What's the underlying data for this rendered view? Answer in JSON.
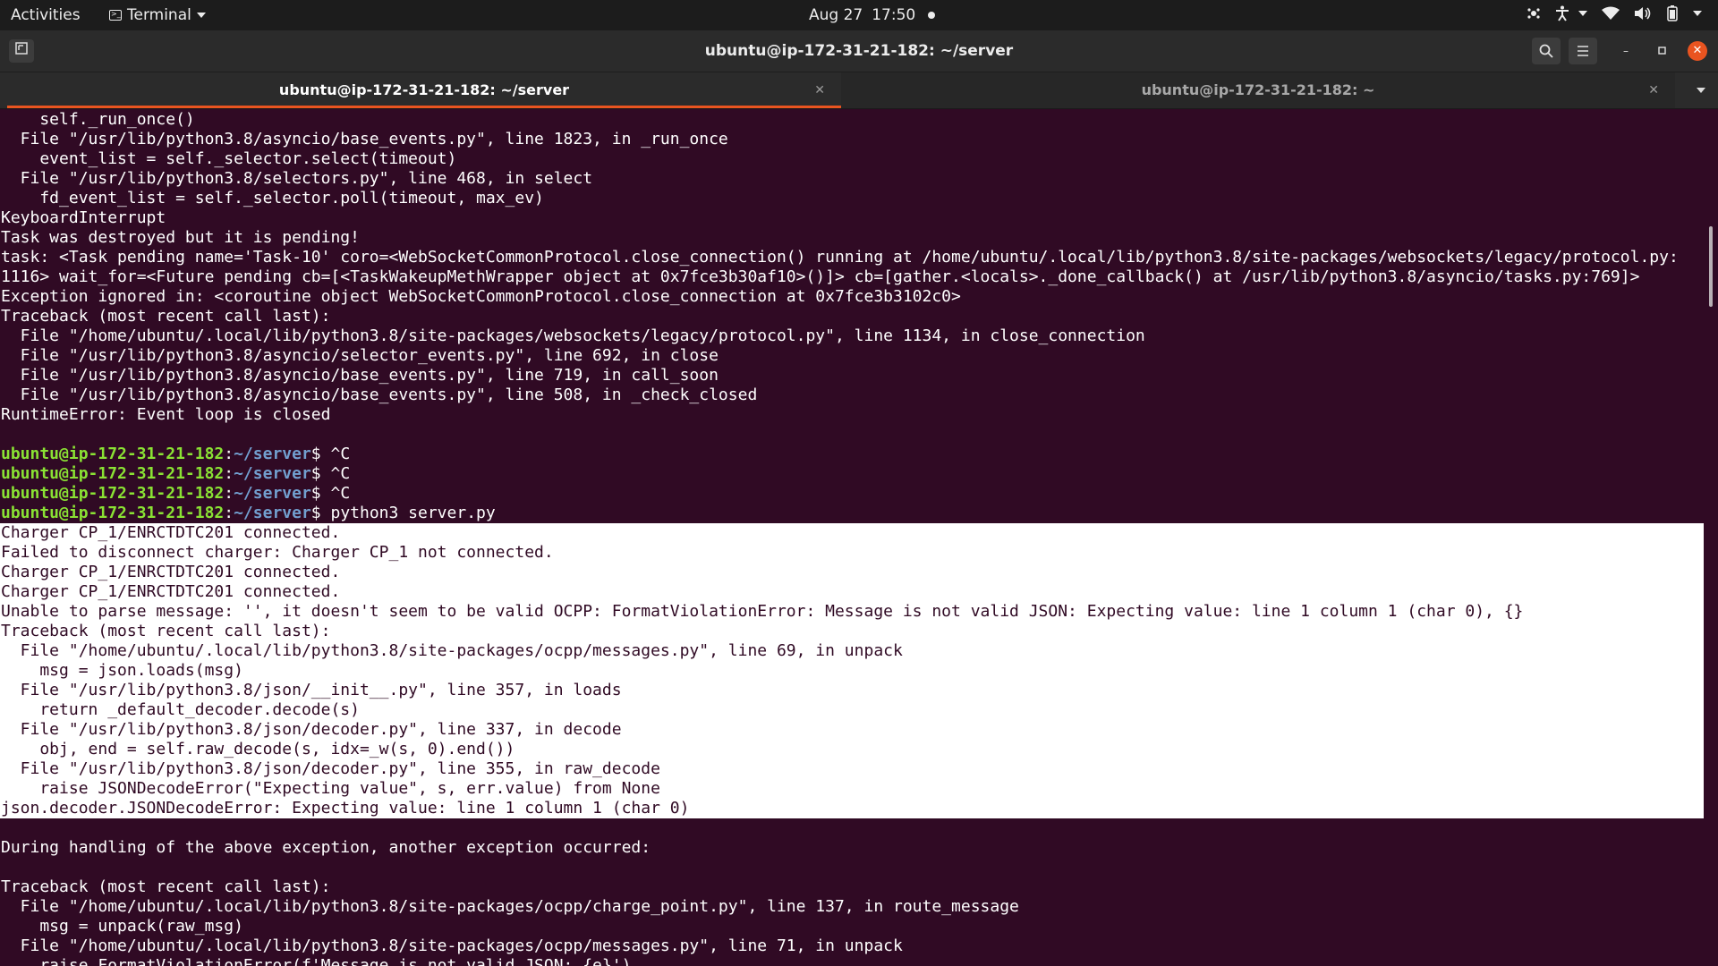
{
  "topbar": {
    "activities": "Activities",
    "app_menu": "Terminal",
    "clock_date": "Aug 27",
    "clock_time": "17:50"
  },
  "window": {
    "title": "ubuntu@ip-172-31-21-182: ~/server"
  },
  "tabs": [
    {
      "label": "ubuntu@ip-172-31-21-182: ~/server",
      "active": true
    },
    {
      "label": "ubuntu@ip-172-31-21-182: ~",
      "active": false
    }
  ],
  "prompt": {
    "user_host": "ubuntu@ip-172-31-21-182",
    "path": "~/server"
  },
  "terminal_lines": [
    {
      "t": "    self._run_once()"
    },
    {
      "t": "  File \"/usr/lib/python3.8/asyncio/base_events.py\", line 1823, in _run_once"
    },
    {
      "t": "    event_list = self._selector.select(timeout)"
    },
    {
      "t": "  File \"/usr/lib/python3.8/selectors.py\", line 468, in select"
    },
    {
      "t": "    fd_event_list = self._selector.poll(timeout, max_ev)"
    },
    {
      "t": "KeyboardInterrupt"
    },
    {
      "t": "Task was destroyed but it is pending!"
    },
    {
      "t": "task: <Task pending name='Task-10' coro=<WebSocketCommonProtocol.close_connection() running at /home/ubuntu/.local/lib/python3.8/site-packages/websockets/legacy/protocol.py:"
    },
    {
      "t": "1116> wait_for=<Future pending cb=[<TaskWakeupMethWrapper object at 0x7fce3b30af10>()]> cb=[gather.<locals>._done_callback() at /usr/lib/python3.8/asyncio/tasks.py:769]>"
    },
    {
      "t": "Exception ignored in: <coroutine object WebSocketCommonProtocol.close_connection at 0x7fce3b3102c0>"
    },
    {
      "t": "Traceback (most recent call last):"
    },
    {
      "t": "  File \"/home/ubuntu/.local/lib/python3.8/site-packages/websockets/legacy/protocol.py\", line 1134, in close_connection"
    },
    {
      "t": "  File \"/usr/lib/python3.8/asyncio/selector_events.py\", line 692, in close"
    },
    {
      "t": "  File \"/usr/lib/python3.8/asyncio/base_events.py\", line 719, in call_soon"
    },
    {
      "t": "  File \"/usr/lib/python3.8/asyncio/base_events.py\", line 508, in _check_closed"
    },
    {
      "t": "RuntimeError: Event loop is closed"
    },
    {
      "t": ""
    },
    {
      "prompt": true,
      "cmd": " ^C"
    },
    {
      "prompt": true,
      "cmd": " ^C"
    },
    {
      "prompt": true,
      "cmd": " ^C"
    },
    {
      "prompt": true,
      "cmd": " python3 server.py"
    },
    {
      "t": "Charger CP_1/ENRCTDTC201 connected.",
      "sel": true
    },
    {
      "t": "Failed to disconnect charger: Charger CP_1 not connected.",
      "sel": true
    },
    {
      "t": "Charger CP_1/ENRCTDTC201 connected.",
      "sel": true
    },
    {
      "t": "Charger CP_1/ENRCTDTC201 connected.",
      "sel": true
    },
    {
      "t": "Unable to parse message: '', it doesn't seem to be valid OCPP: FormatViolationError: Message is not valid JSON: Expecting value: line 1 column 1 (char 0), {}",
      "sel": true
    },
    {
      "t": "Traceback (most recent call last):",
      "sel": true
    },
    {
      "t": "  File \"/home/ubuntu/.local/lib/python3.8/site-packages/ocpp/messages.py\", line 69, in unpack",
      "sel": true
    },
    {
      "t": "    msg = json.loads(msg)",
      "sel": true
    },
    {
      "t": "  File \"/usr/lib/python3.8/json/__init__.py\", line 357, in loads",
      "sel": true
    },
    {
      "t": "    return _default_decoder.decode(s)",
      "sel": true
    },
    {
      "t": "  File \"/usr/lib/python3.8/json/decoder.py\", line 337, in decode",
      "sel": true
    },
    {
      "t": "    obj, end = self.raw_decode(s, idx=_w(s, 0).end())",
      "sel": true
    },
    {
      "t": "  File \"/usr/lib/python3.8/json/decoder.py\", line 355, in raw_decode",
      "sel": true
    },
    {
      "t": "    raise JSONDecodeError(\"Expecting value\", s, err.value) from None",
      "sel": true
    },
    {
      "t": "json.decoder.JSONDecodeError: Expecting value: line 1 column 1 (char 0)",
      "sel": true
    },
    {
      "t": ""
    },
    {
      "t": "During handling of the above exception, another exception occurred:"
    },
    {
      "t": ""
    },
    {
      "t": "Traceback (most recent call last):"
    },
    {
      "t": "  File \"/home/ubuntu/.local/lib/python3.8/site-packages/ocpp/charge_point.py\", line 137, in route_message"
    },
    {
      "t": "    msg = unpack(raw_msg)"
    },
    {
      "t": "  File \"/home/ubuntu/.local/lib/python3.8/site-packages/ocpp/messages.py\", line 71, in unpack"
    },
    {
      "t": "    raise FormatViolationError(f'Message is not valid JSON: {e}')"
    }
  ],
  "colors": {
    "terminal_bg": "#300a24",
    "prompt_user": "#8ae234",
    "prompt_path": "#729fcf",
    "accent": "#e95420"
  },
  "icons": {
    "new_tab": "new-tab-icon",
    "search": "search-icon",
    "menu": "hamburger-menu-icon",
    "minimize": "minimize-icon",
    "maximize": "maximize-icon",
    "close": "close-icon"
  }
}
